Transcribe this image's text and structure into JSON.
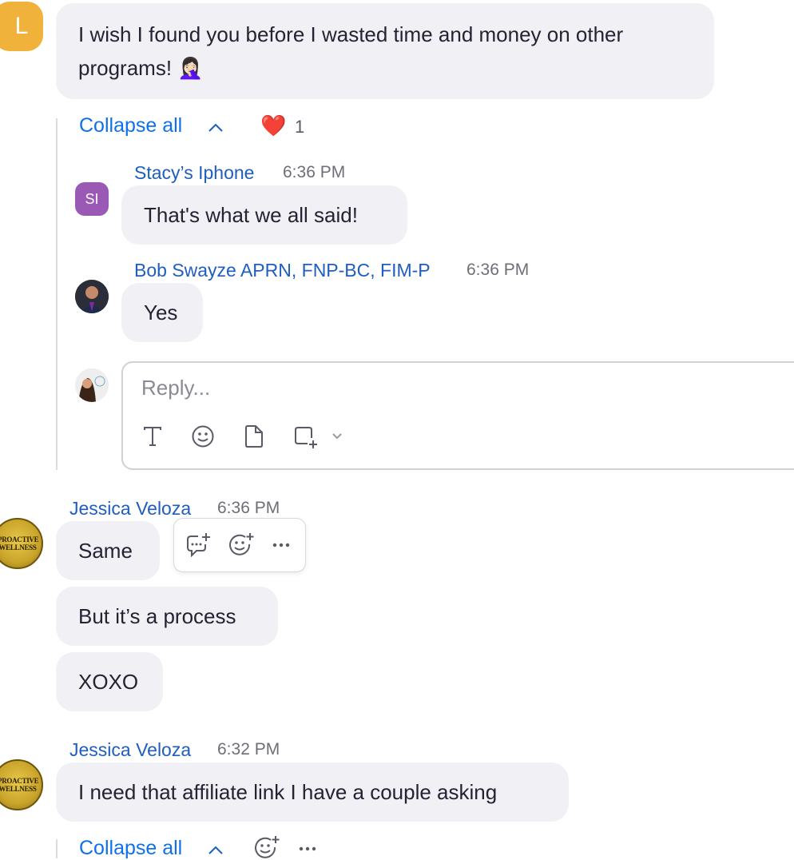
{
  "messages": {
    "first": {
      "avatar_letter": "L",
      "text": "I wish I found you before I wasted time and money on other programs! 🤦🏻‍♀️"
    },
    "thread": {
      "collapse_label": "Collapse all",
      "reaction_emoji": "❤️",
      "reaction_count": "1",
      "replies": [
        {
          "initials": "SI",
          "name": "Stacy’s Iphone",
          "time": "6:36 PM",
          "text": "That's what we all said!"
        },
        {
          "name": "Bob Swayze APRN, FNP-BC, FIM-P",
          "time": "6:36 PM",
          "text": "Yes"
        }
      ],
      "reply_placeholder": "Reply..."
    },
    "jessica_1": {
      "name": "Jessica Veloza",
      "time": "6:36 PM",
      "texts": [
        "Same",
        "But it’s a process",
        "XOXO"
      ],
      "badge_text": "PROACTIVE WELLNESS"
    },
    "jessica_2": {
      "name": "Jessica Veloza",
      "time": "6:32 PM",
      "text": "I need that affiliate link I have a couple asking",
      "badge_text": "PROACTIVE WELLNESS",
      "collapse_label": "Collapse all"
    }
  },
  "icons": {
    "format_text": "format-text-icon",
    "emoji": "emoji-icon",
    "file": "file-icon",
    "screenshot": "screenshot-icon",
    "chevron": "chevron-down-icon",
    "reply_thread": "reply-thread-icon",
    "add_reaction": "add-reaction-icon",
    "more": "more-options-icon"
  },
  "colors": {
    "accent": "#0e71eb",
    "name_blue": "#1f5dbf",
    "bubble_bg": "#f1f1f5",
    "avatar_L": "#f0b23a",
    "avatar_SI": "#9b59b6"
  }
}
